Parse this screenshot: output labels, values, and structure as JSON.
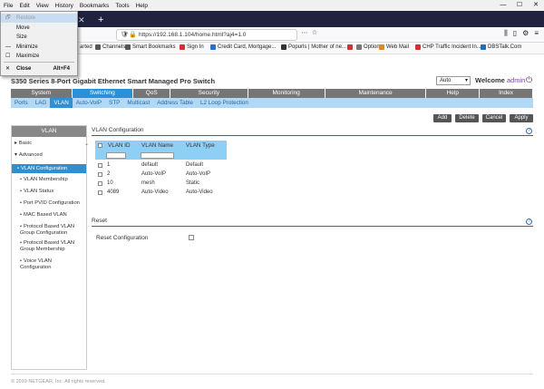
{
  "menubar": {
    "items": [
      "File",
      "Edit",
      "View",
      "History",
      "Bookmarks",
      "Tools",
      "Help"
    ]
  },
  "window_controls": {
    "minimize": "—",
    "restore": "☐",
    "close": "✕"
  },
  "tab": {
    "close_glyph": "✕",
    "new_tab_glyph": "+"
  },
  "navbar": {
    "url": "https://192.168.1.104/home.html?aj4=1.0"
  },
  "bookmarks": [
    {
      "label": "arted",
      "color": "#e8a33d"
    },
    {
      "label": "Channels",
      "color": "#555"
    },
    {
      "label": "Smart Bookmarks",
      "color": "#555"
    },
    {
      "label": "Sign In",
      "color": "#c33"
    },
    {
      "label": "Credit Card, Mortgage...",
      "color": "#2a6fc9"
    },
    {
      "label": "Popurls | Mother of ne...",
      "color": "#333"
    },
    {
      "label": "",
      "color": "#c33"
    },
    {
      "label": "Options",
      "color": "#777"
    },
    {
      "label": "Web Mail",
      "color": "#e08a1e"
    },
    {
      "label": "CHP Traffic Incident In...",
      "color": "#c33"
    },
    {
      "label": "DBSTalk.Com",
      "color": "#1e6fb8"
    }
  ],
  "sysmenu": {
    "items": [
      {
        "label": "Restore",
        "glyph": "🗗",
        "shortcut": "",
        "disabled": true
      },
      {
        "label": "Move",
        "glyph": "",
        "shortcut": "",
        "disabled": false
      },
      {
        "label": "Size",
        "glyph": "",
        "shortcut": "",
        "disabled": false
      },
      {
        "label": "Minimize",
        "glyph": "—",
        "shortcut": "",
        "disabled": false
      },
      {
        "label": "Maximize",
        "glyph": "☐",
        "shortcut": "",
        "disabled": false
      },
      {
        "label": "Close",
        "glyph": "✕",
        "shortcut": "Alt+F4",
        "disabled": false
      }
    ]
  },
  "header": {
    "product_title": "S350 Series 8-Port Gigabit Ethernet Smart Managed Pro Switch",
    "auto_select": "Auto",
    "welcome": "Welcome",
    "user": "admin"
  },
  "main_nav": [
    {
      "label": "System",
      "active": false
    },
    {
      "label": "Switching",
      "active": true
    },
    {
      "label": "QoS",
      "active": false
    },
    {
      "label": "Security",
      "active": false
    },
    {
      "label": "Monitoring",
      "active": false
    },
    {
      "label": "Maintenance",
      "active": false
    },
    {
      "label": "Help",
      "active": false
    },
    {
      "label": "Index",
      "active": false
    }
  ],
  "sub_nav": [
    {
      "label": "Ports",
      "active": false
    },
    {
      "label": "LAG",
      "active": false
    },
    {
      "label": "VLAN",
      "active": true
    },
    {
      "label": "Auto-VoIP",
      "active": false
    },
    {
      "label": "STP",
      "active": false
    },
    {
      "label": "Multicast",
      "active": false
    },
    {
      "label": "Address Table",
      "active": false
    },
    {
      "label": "L2 Loop Protection",
      "active": false
    }
  ],
  "actions": {
    "add": "Add",
    "delete": "Delete",
    "cancel": "Cancel",
    "apply": "Apply"
  },
  "left_panel": {
    "title": "VLAN",
    "items": [
      {
        "label": "Basic",
        "prefix": "▸",
        "active": false
      },
      {
        "label": "Advanced",
        "prefix": "▾",
        "active": false
      },
      {
        "label": "VLAN Configuration",
        "prefix": "•",
        "active": true
      },
      {
        "label": "VLAN Membership",
        "prefix": "•",
        "active": false
      },
      {
        "label": "VLAN Status",
        "prefix": "•",
        "active": false
      },
      {
        "label": "Port PVID Configuration",
        "prefix": "•",
        "active": false
      },
      {
        "label": "MAC Based VLAN",
        "prefix": "•",
        "active": false
      },
      {
        "label": "Protocol Based VLAN Group Configuration",
        "prefix": "•",
        "active": false
      },
      {
        "label": "Protocol Based VLAN Group Membership",
        "prefix": "•",
        "active": false
      },
      {
        "label": "Voice VLAN Configuration",
        "prefix": "•",
        "active": false
      }
    ]
  },
  "vlan_config": {
    "title": "VLAN Configuration",
    "columns": [
      "VLAN ID",
      "VLAN Name",
      "VLAN Type"
    ],
    "rows": [
      {
        "id": "1",
        "name": "default",
        "type": "Default"
      },
      {
        "id": "2",
        "name": "Auto-VoIP",
        "type": "Auto-VoIP"
      },
      {
        "id": "10",
        "name": "mesh",
        "type": "Static"
      },
      {
        "id": "4089",
        "name": "Auto-Video",
        "type": "Auto-Video"
      }
    ]
  },
  "reset": {
    "title": "Reset",
    "label": "Reset Configuration"
  },
  "help_glyph": "?",
  "footer": "© 2019 NETGEAR, Inc. All rights reserved."
}
